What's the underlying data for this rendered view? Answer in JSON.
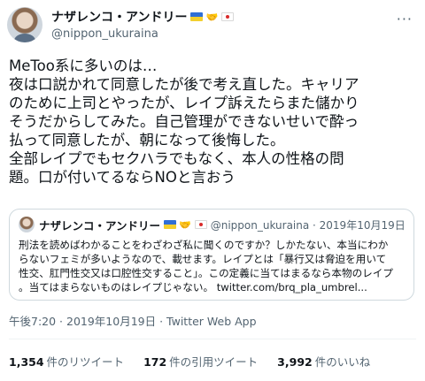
{
  "author": {
    "display_name": "ナザレンコ・アンドリー",
    "handle": "@nippon_ukuraina"
  },
  "tweet": {
    "lines": [
      "MeToo系に多いのは…",
      "夜は口説かれて同意したが後で考え直した。キャリア",
      "のために上司とやったが、レイプ訴えたらまた儲かり",
      "そうだからしてみた。自己管理ができないせいで酔っ",
      "払って同意したが、朝になって後悔した。",
      "全部レイプでもセクハラでもなく、本人の性格の問",
      "題。口が付いてるならNOと言おう"
    ],
    "meta": "午後7:20 · 2019年10月19日 · Twitter Web App"
  },
  "quote": {
    "display_name": "ナザレンコ・アンドリー",
    "handle_date": "@nippon_ukuraina · 2019年10月19日",
    "lines": [
      "刑法を読めばわかることをわざわざ私に聞くのですか？しかたない、本当にわか",
      "らないフェミが多いようなので、載せます。レイプとは「暴行又は脅迫を用いて",
      "性交、肛門性交又は口腔性交すること」。この定義に当てはまるなら本物のレイプ",
      "。当てはまらないものはレイプじゃない。"
    ],
    "link": "twitter.com/brq_pla_umbrel..."
  },
  "stats": {
    "retweets_count": "1,354",
    "retweets_label": "件のリツイート",
    "quotes_count": "172",
    "quotes_label": "件の引用ツイート",
    "likes_count": "3,992",
    "likes_label": "件のいいね"
  },
  "colors": {
    "text": "#0f1419",
    "secondary": "#536471",
    "border": "#cfd9de"
  },
  "icons": [
    "more-options-icon",
    "ukraine-flag-icon",
    "handshake-icon",
    "japan-flag-icon"
  ]
}
